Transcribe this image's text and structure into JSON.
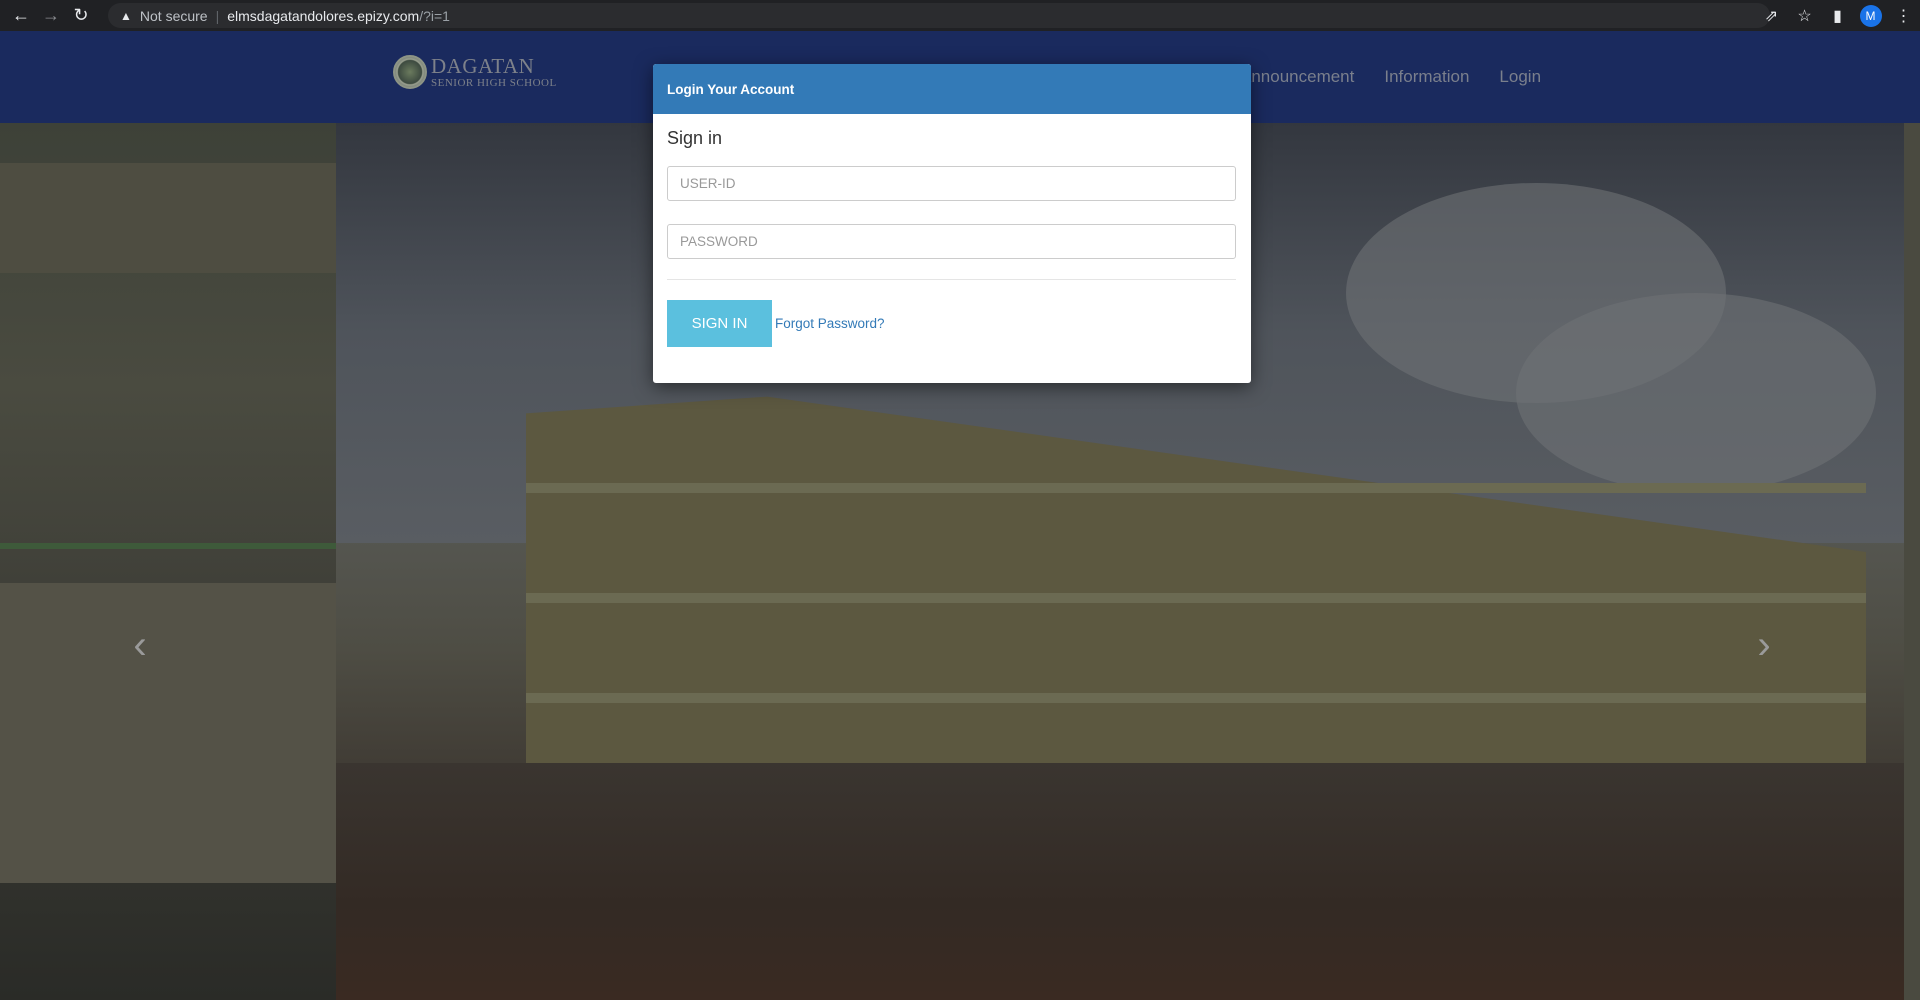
{
  "browser": {
    "security_label": "Not secure",
    "url_host": "elmsdagatandolores.epizy.com",
    "url_path": "/?i=1",
    "profile_initial": "M"
  },
  "site": {
    "logo_line1": "DAGATAN",
    "logo_line2": "SENIOR HIGH SCHOOL",
    "nav": {
      "announcement": "Announcement",
      "information": "Information",
      "login": "Login"
    }
  },
  "modal": {
    "header": "Login Your Account",
    "title": "Sign in",
    "userid_placeholder": "USER-ID",
    "password_placeholder": "PASSWORD",
    "signin_label": "SIGN IN",
    "forgot_label": "Forgot Password?"
  },
  "colors": {
    "header_bg": "#1a2a5e",
    "modal_header": "#337ab7",
    "signin_button": "#5bc0de",
    "link": "#337ab7"
  },
  "icons": {
    "back": "arrow-left-icon",
    "forward": "arrow-right-icon",
    "reload": "reload-icon",
    "warning": "warning-icon",
    "share": "share-icon",
    "bookmark": "star-icon",
    "sidepanel": "side-panel-icon",
    "menu": "kebab-menu-icon",
    "carousel_prev": "chevron-left-icon",
    "carousel_next": "chevron-right-icon"
  }
}
